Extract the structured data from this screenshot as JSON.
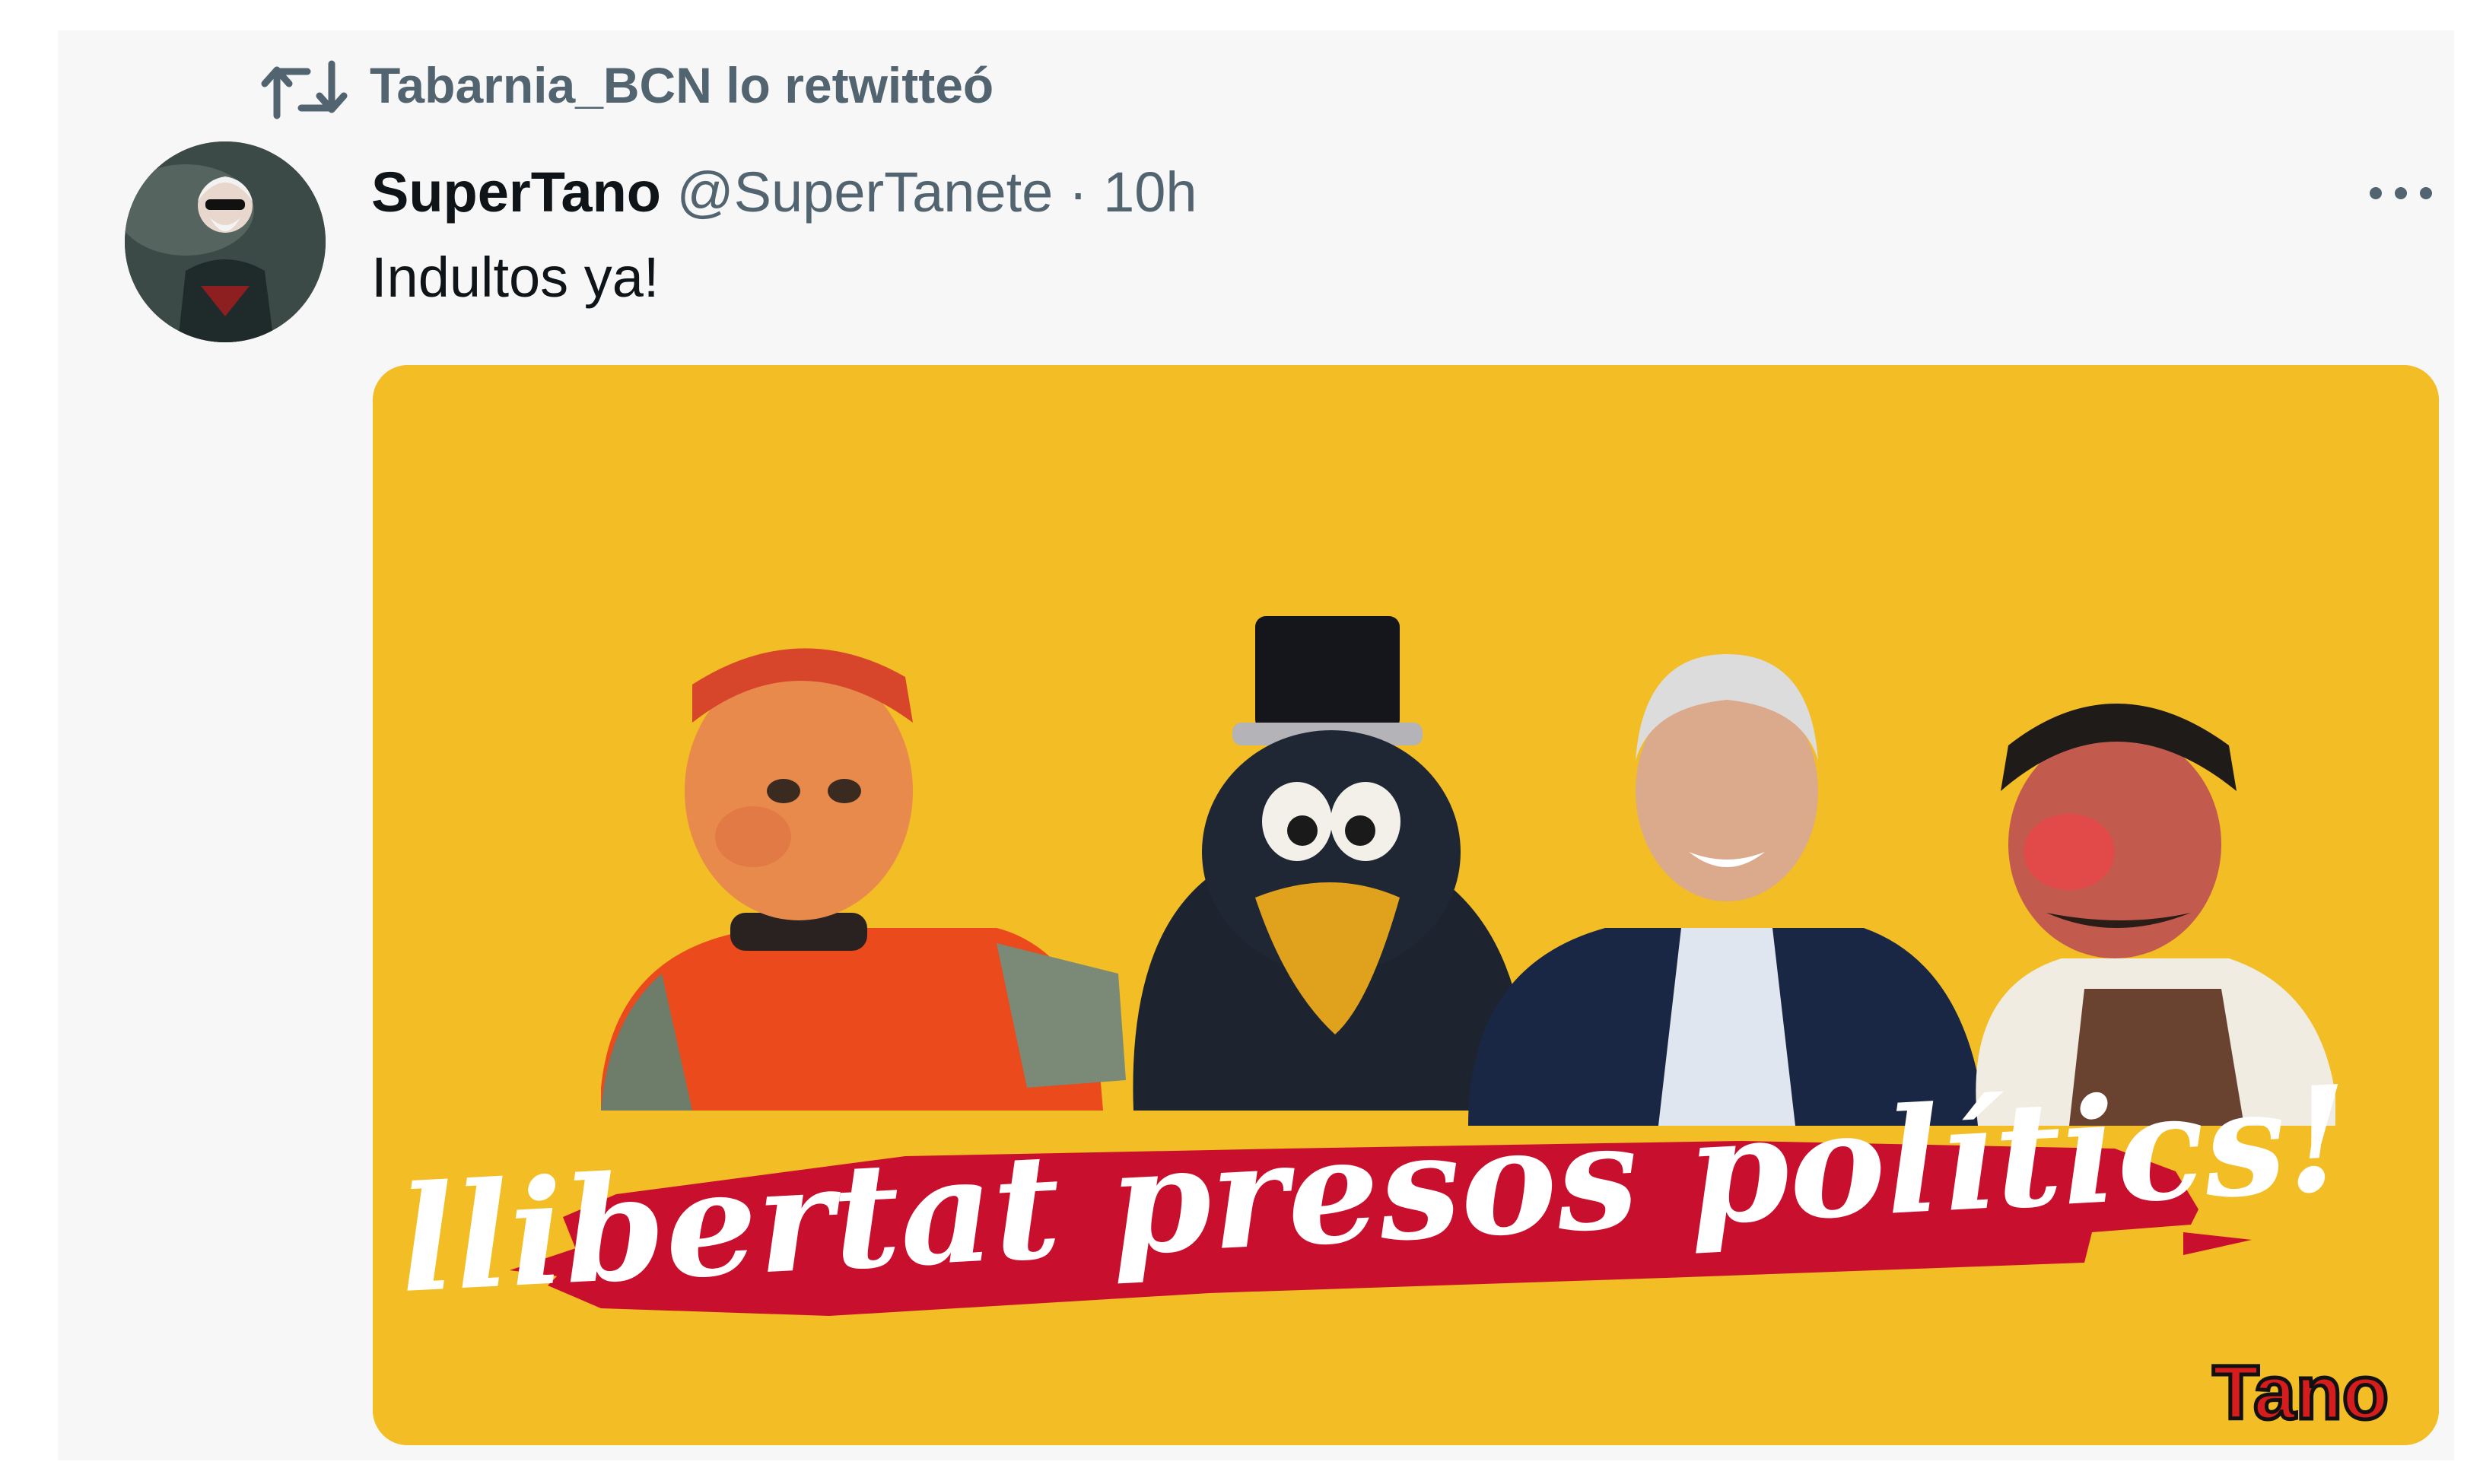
{
  "retweet": {
    "icon": "retweet-icon",
    "label": "Tabarnia_BCN lo retwitteó"
  },
  "tweet": {
    "display_name": "SuperTano",
    "handle": "@SuperTanete",
    "separator": "·",
    "time": "10h",
    "text": "Indultos ya!",
    "more_icon": "more-dots-icon",
    "media": {
      "banner_text": "llibertat presos polítics!",
      "watermark": "Tano",
      "background_color": "#f2bd25",
      "banner_color": "#c8102e"
    }
  }
}
